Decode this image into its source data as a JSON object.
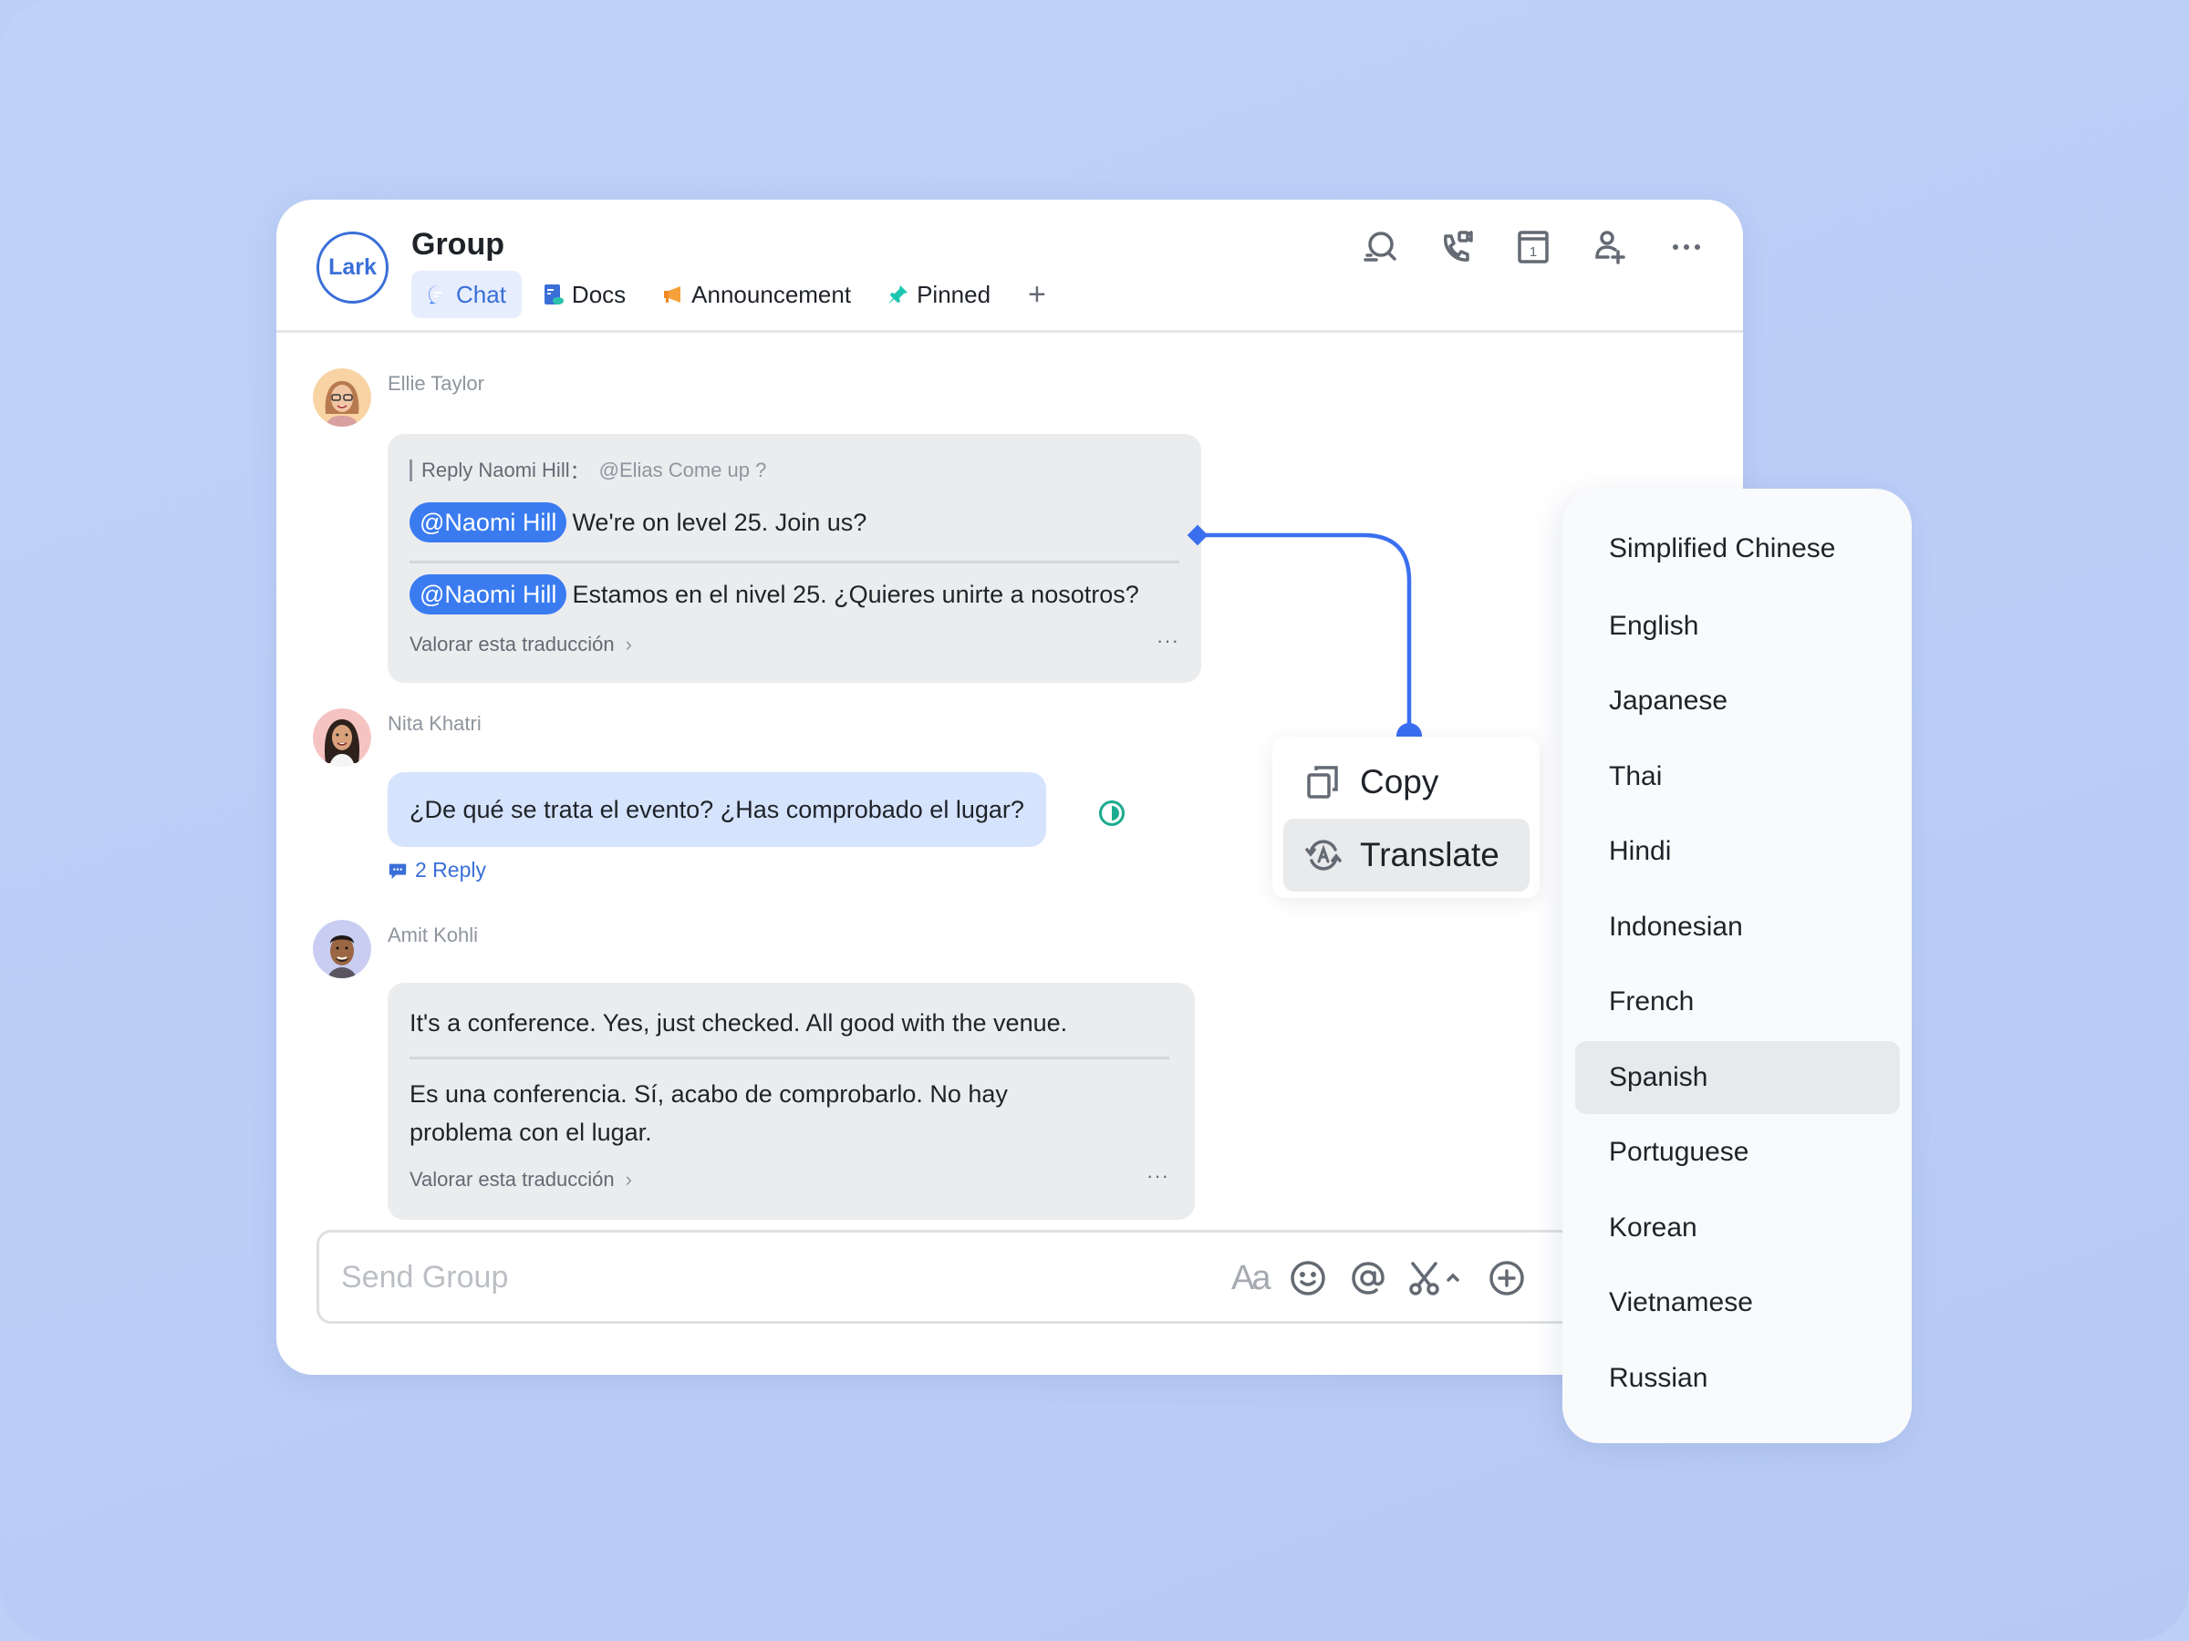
{
  "app": {
    "logo_text": "Lark",
    "title": "Group"
  },
  "tabs": [
    {
      "label": "Chat",
      "icon": "chat-bubble-icon",
      "active": true
    },
    {
      "label": "Docs",
      "icon": "docs-icon",
      "active": false
    },
    {
      "label": "Announcement",
      "icon": "megaphone-icon",
      "active": false
    },
    {
      "label": "Pinned",
      "icon": "pin-icon",
      "active": false
    }
  ],
  "header_actions": [
    "search-icon",
    "call-video-icon",
    "calendar-icon",
    "add-member-icon",
    "more-icon"
  ],
  "calendar_day": "1",
  "messages": [
    {
      "sender": "Ellie Taylor",
      "reply_label": "Reply Naomi Hill",
      "reply_sep": "：",
      "reply_text": "@Elias Come up ?",
      "mention": "@Naomi Hill",
      "original": "We're on level 25. Join us?",
      "translated": "Estamos en el nivel 25. ¿Quieres unirte a nosotros?",
      "rate_label": "Valorar esta traducción",
      "more": "···"
    },
    {
      "sender": "Nita Khatri",
      "text": "¿De qué se trata el evento? ¿Has comprobado el lugar?",
      "reply_count": "2 Reply"
    },
    {
      "sender": "Amit Kohli",
      "original": "It's a conference. Yes, just checked. All good with the venue.",
      "translated": "Es una conferencia. Sí, acabo de comprobarlo. No hay problema con el lugar.",
      "rate_label": "Valorar esta traducción",
      "more": "···"
    }
  ],
  "input": {
    "placeholder": "Send Group",
    "tools": [
      "text-format-icon",
      "emoji-icon",
      "mention-icon",
      "screenshot-icon",
      "add-icon"
    ],
    "format_glyph": "Aa"
  },
  "context_menu": {
    "items": [
      {
        "label": "Copy",
        "icon": "copy-icon",
        "active": false
      },
      {
        "label": "Translate",
        "icon": "translate-icon",
        "active": true
      }
    ]
  },
  "languages": {
    "items": [
      "Simplified Chinese",
      "English",
      "Japanese",
      "Thai",
      "Hindi",
      "Indonesian",
      "French",
      "Spanish",
      "Portuguese",
      "Korean",
      "Vietnamese",
      "Russian"
    ],
    "selected": "Spanish"
  },
  "colors": {
    "accent": "#3a7bf0",
    "background": "#bccff7",
    "bubble_gray": "#ebecee",
    "bubble_blue": "#d5e3fd",
    "status_green": "#1bab8e"
  }
}
